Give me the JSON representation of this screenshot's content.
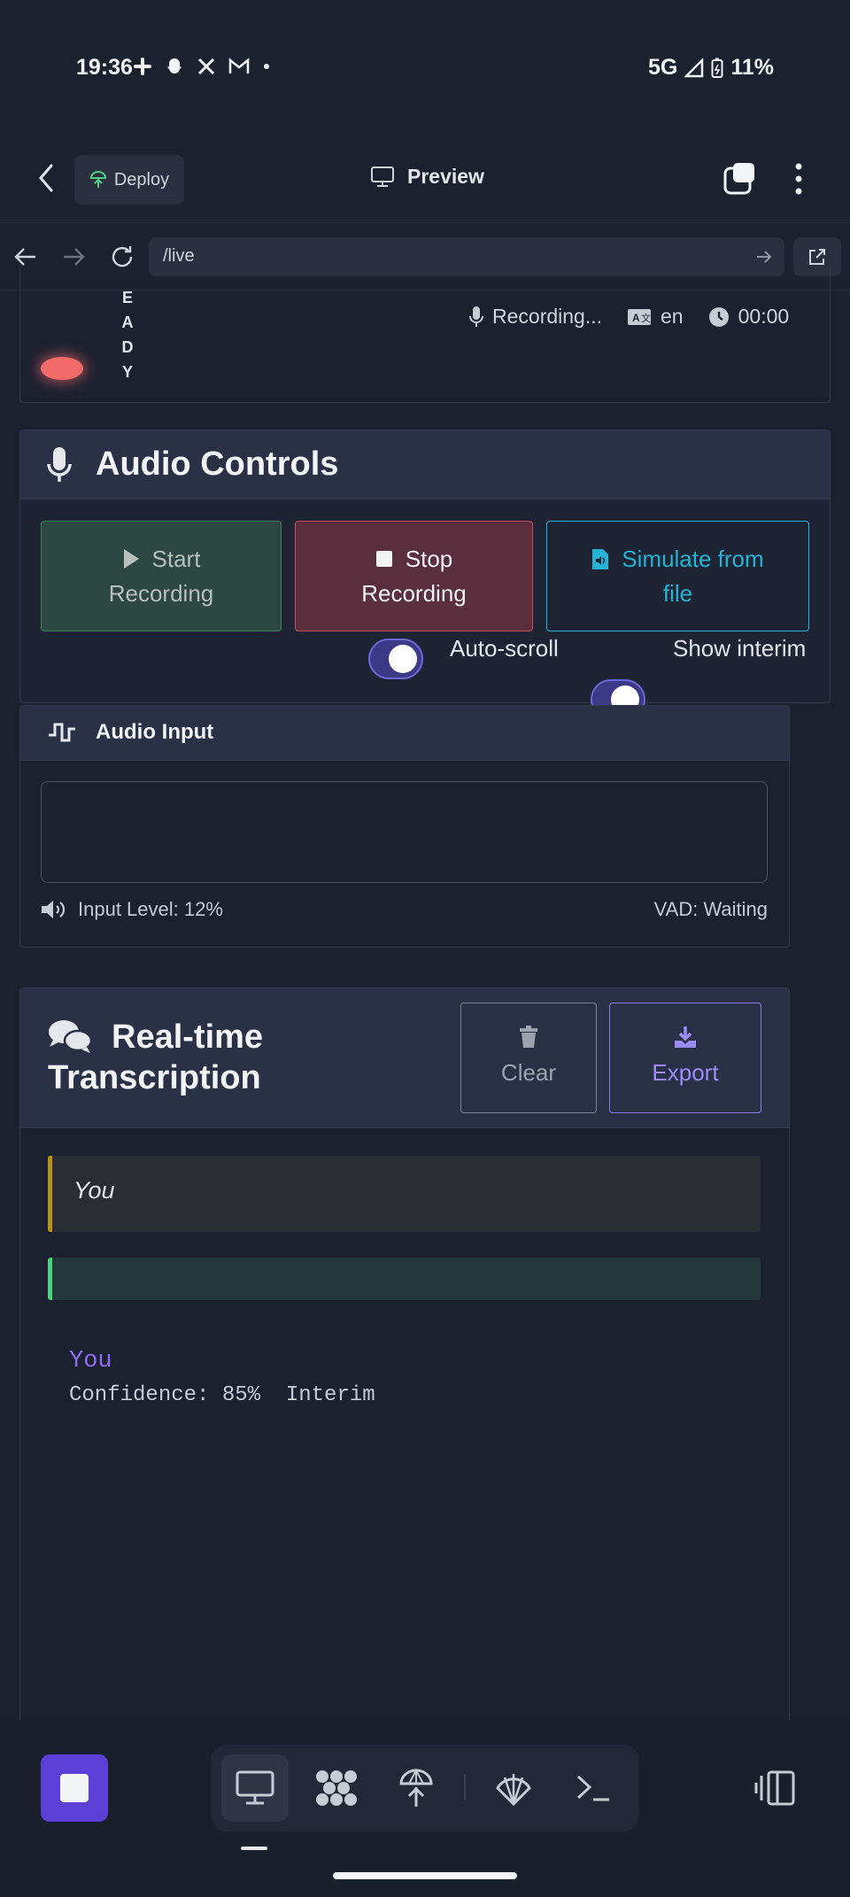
{
  "status_bar": {
    "time": "19:36",
    "network": "5G",
    "battery": "11%",
    "notification_icons": [
      "slack-icon",
      "snapchat-icon",
      "x-icon",
      "gmail-icon",
      "dot-icon"
    ]
  },
  "app_bar": {
    "deploy_label": "Deploy",
    "preview_label": "Preview"
  },
  "url_bar": {
    "url": "/live"
  },
  "status_panel": {
    "ready_letters": [
      "E",
      "A",
      "D",
      "Y"
    ],
    "recording_label": "Recording...",
    "language": "en",
    "timer": "00:00"
  },
  "audio_controls": {
    "title": "Audio Controls",
    "start_line1": "Start",
    "start_line2": "Recording",
    "stop_line1": "Stop",
    "stop_line2": "Recording",
    "simulate_line1": "Simulate from",
    "simulate_line2": "file",
    "auto_scroll_label": "Auto-scroll",
    "auto_scroll_on": true,
    "show_interim_label": "Show interim",
    "show_interim_on": true
  },
  "audio_input": {
    "title": "Audio Input",
    "input_level": "Input Level: 12%",
    "vad": "VAD: Waiting"
  },
  "transcription": {
    "title_line1": "Real-time",
    "title_line2": "Transcription",
    "clear_label": "Clear",
    "export_label": "Export",
    "message1_speaker": "You",
    "interim_speaker": "You",
    "interim_meta": "Confidence: 85%  Interim"
  },
  "colors": {
    "background": "#1c2130",
    "accent": "#5b3fd6",
    "recording_dot": "#f26a6a",
    "simulate": "#22b3d5",
    "export": "#9d8cf8"
  }
}
